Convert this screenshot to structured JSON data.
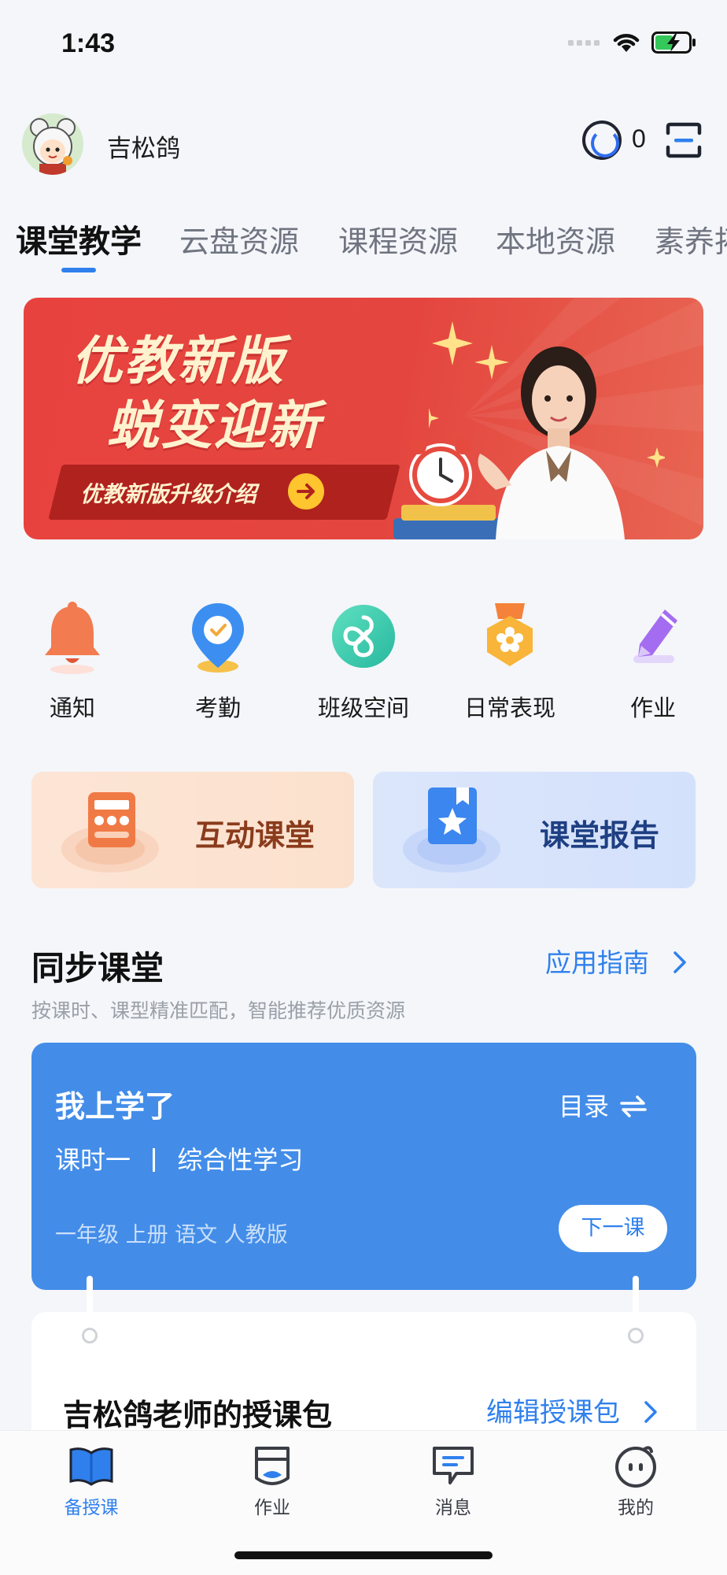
{
  "status_bar": {
    "time": "1:43"
  },
  "header": {
    "username": "吉松鸽",
    "coin_count": "0"
  },
  "tabs": [
    {
      "label": "课堂教学",
      "active": true
    },
    {
      "label": "云盘资源"
    },
    {
      "label": "课程资源"
    },
    {
      "label": "本地资源"
    },
    {
      "label": "素养拓"
    }
  ],
  "banner": {
    "title_line1": "优教新版",
    "title_line2": "蜕变迎新",
    "pill_text": "优教新版升级介绍"
  },
  "quick_actions": [
    {
      "label": "通知",
      "icon": "bell-icon"
    },
    {
      "label": "考勤",
      "icon": "location-check-icon"
    },
    {
      "label": "班级空间",
      "icon": "class-space-icon"
    },
    {
      "label": "日常表现",
      "icon": "badge-icon"
    },
    {
      "label": "作业",
      "icon": "homework-pen-icon"
    }
  ],
  "feature_cards": {
    "interactive": {
      "label": "互动课堂",
      "icon": "calculator-icon",
      "color": "#8a3b1c"
    },
    "report": {
      "label": "课堂报告",
      "icon": "bookmark-star-icon",
      "color": "#1e3f82"
    }
  },
  "sync_section": {
    "title": "同步课堂",
    "guide_link": "应用指南",
    "subtitle": "按课时、课型精准匹配，智能推荐优质资源"
  },
  "lesson_card": {
    "title": "我上学了",
    "catalog_label": "目录",
    "lesson_label": "课时一",
    "lesson_topic": "综合性学习",
    "meta": "一年级 上册 语文 人教版",
    "next_button": "下一课"
  },
  "package_card": {
    "title": "吉松鸽老师的授课包",
    "edit_link": "编辑授课包"
  },
  "bottom_nav": [
    {
      "label": "备授课",
      "icon": "open-book-icon",
      "active": true
    },
    {
      "label": "作业",
      "icon": "homework-icon"
    },
    {
      "label": "消息",
      "icon": "message-icon"
    },
    {
      "label": "我的",
      "icon": "profile-face-icon"
    }
  ],
  "accent_color": "#2f80ed"
}
